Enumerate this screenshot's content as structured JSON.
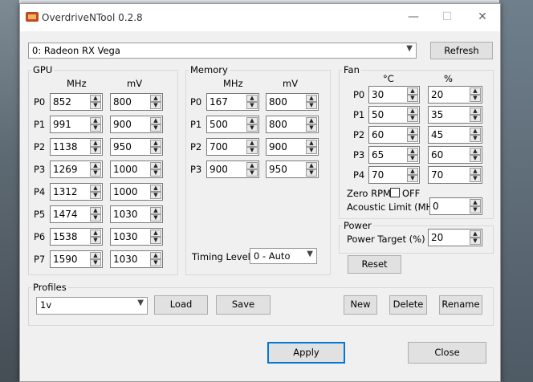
{
  "window": {
    "title": "OverdriveNTool 0.2.8",
    "minimize": "—",
    "maximize": "☐",
    "close": "✕"
  },
  "device": {
    "selected": "0: Radeon RX Vega"
  },
  "refresh_label": "Refresh",
  "gpu": {
    "title": "GPU",
    "col_mhz": "MHz",
    "col_mv": "mV",
    "states": [
      {
        "label": "P0",
        "mhz": "852",
        "mv": "800"
      },
      {
        "label": "P1",
        "mhz": "991",
        "mv": "900"
      },
      {
        "label": "P2",
        "mhz": "1138",
        "mv": "950"
      },
      {
        "label": "P3",
        "mhz": "1269",
        "mv": "1000"
      },
      {
        "label": "P4",
        "mhz": "1312",
        "mv": "1000"
      },
      {
        "label": "P5",
        "mhz": "1474",
        "mv": "1030"
      },
      {
        "label": "P6",
        "mhz": "1538",
        "mv": "1030"
      },
      {
        "label": "P7",
        "mhz": "1590",
        "mv": "1030"
      }
    ]
  },
  "memory": {
    "title": "Memory",
    "col_mhz": "MHz",
    "col_mv": "mV",
    "states": [
      {
        "label": "P0",
        "mhz": "167",
        "mv": "800"
      },
      {
        "label": "P1",
        "mhz": "500",
        "mv": "800"
      },
      {
        "label": "P2",
        "mhz": "700",
        "mv": "900"
      },
      {
        "label": "P3",
        "mhz": "900",
        "mv": "950"
      }
    ],
    "timing_label": "Timing Level",
    "timing_value": "0 - Auto"
  },
  "fan": {
    "title": "Fan",
    "col_c": "°C",
    "col_pct": "%",
    "states": [
      {
        "label": "P0",
        "c": "30",
        "pct": "20"
      },
      {
        "label": "P1",
        "c": "50",
        "pct": "35"
      },
      {
        "label": "P2",
        "c": "60",
        "pct": "45"
      },
      {
        "label": "P3",
        "c": "65",
        "pct": "60"
      },
      {
        "label": "P4",
        "c": "70",
        "pct": "70"
      }
    ],
    "zero_rpm_label": "Zero RPM",
    "zero_rpm_state": "OFF",
    "acoustic_label": "Acoustic Limit (MHz)",
    "acoustic_value": "0"
  },
  "power": {
    "title": "Power",
    "target_label": "Power Target (%)",
    "target_value": "20"
  },
  "reset_label": "Reset",
  "profiles": {
    "title": "Profiles",
    "selected": "1v",
    "load": "Load",
    "save": "Save",
    "new": "New",
    "delete": "Delete",
    "rename": "Rename"
  },
  "apply_label": "Apply",
  "close_label": "Close"
}
